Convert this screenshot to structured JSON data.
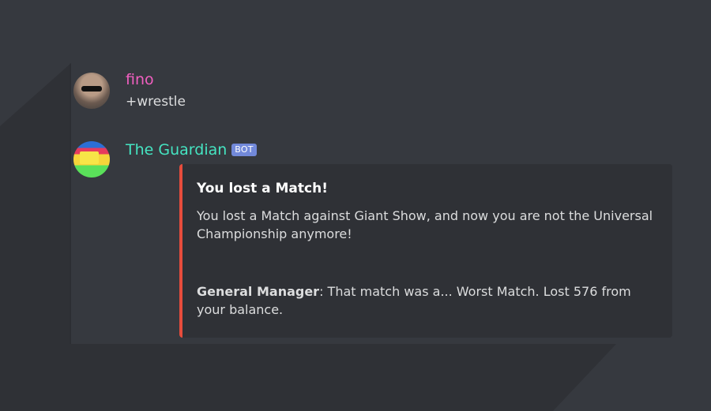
{
  "messages": [
    {
      "author": "fino",
      "text": "+wrestle"
    },
    {
      "author": "The Guardian",
      "bot_tag": "BOT",
      "embed": {
        "accent_color": "#e74c3c",
        "title": "You lost a Match!",
        "description": "You lost a Match against Giant Show, and now you are not the Universal Championship anymore!",
        "field_label": "General Manager",
        "field_text": ": That match was a... Worst Match. Lost 576 from your balance."
      }
    }
  ],
  "colors": {
    "background": "#36393f",
    "embed_background": "#2f3136",
    "fino_name": "#f15fc0",
    "guardian_name": "#45e5c2",
    "bot_tag": "#7289da"
  }
}
